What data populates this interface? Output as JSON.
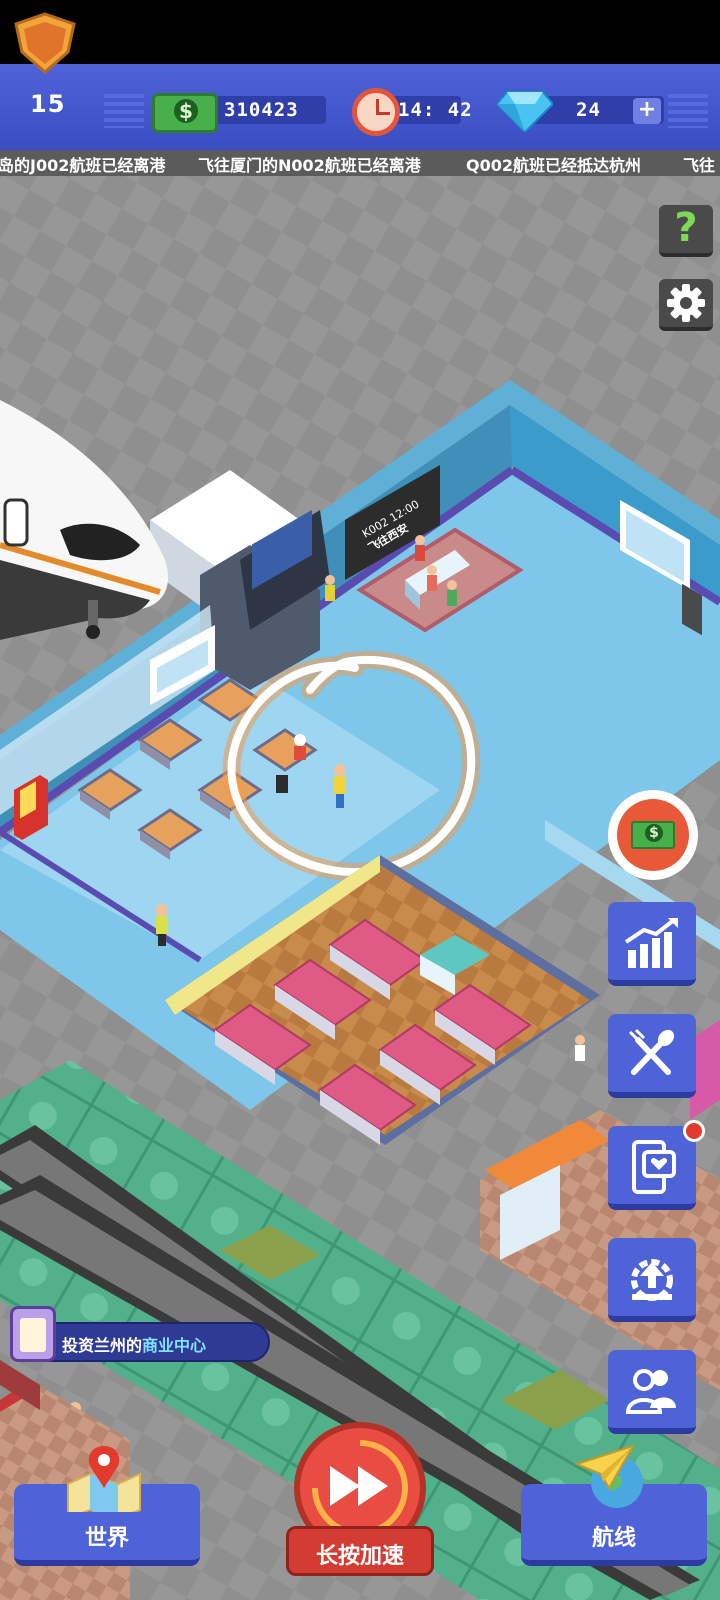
{
  "hud": {
    "level": "15",
    "money": "310423",
    "time": "14: 42",
    "gems": "24",
    "plus_label": "+"
  },
  "ticker": [
    "岛的J002航班已经离港",
    "飞往厦门的N002航班已经离港",
    "Q002航班已经抵达杭州",
    "飞往"
  ],
  "side_buttons": {
    "help_label": "?"
  },
  "scene": {
    "gate_sign_line1": "K002 12:00",
    "gate_sign_line2": "飞往西安"
  },
  "quest": {
    "prefix": "投资兰州的",
    "highlight": "商业中心"
  },
  "bottom": {
    "world_label": "世界",
    "speed_label": "长按加速",
    "routes_label": "航线"
  },
  "colors": {
    "hud_blue": "#4f63d8",
    "button_red": "#e84c42",
    "annotation_circle": "#ffffff",
    "annotation_glow": "#f29a4a"
  }
}
